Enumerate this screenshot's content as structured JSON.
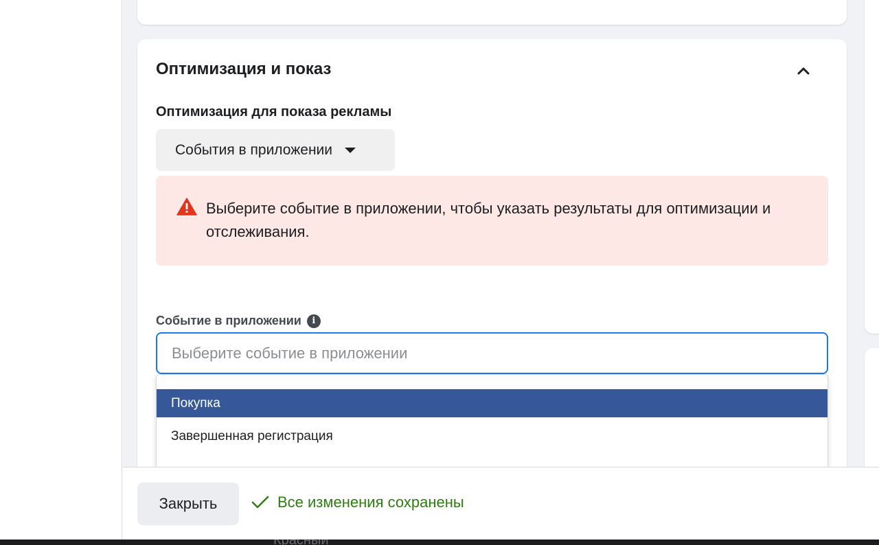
{
  "section": {
    "title": "Оптимизация и показ",
    "optimization_label": "Оптимизация для показа рекламы",
    "optimization_value": "События в приложении"
  },
  "alert": {
    "message": "Выберите событие в приложении, чтобы указать результаты для оптимизации и отслеживания.",
    "color": "#fde8e6"
  },
  "app_event": {
    "label": "Событие в приложении",
    "placeholder": "Выберите событие в приложении",
    "options": [
      {
        "label": "Покупка",
        "selected": true
      },
      {
        "label": "Завершенная регистрация",
        "selected": false
      }
    ]
  },
  "footer": {
    "close_label": "Закрыть",
    "saved_status": "Все изменения сохранены",
    "saved_color": "#2e7d12"
  },
  "bottom_strip": {
    "peek_text": "Красный"
  },
  "colors": {
    "accent": "#1877f2",
    "selected_row": "#365899"
  }
}
